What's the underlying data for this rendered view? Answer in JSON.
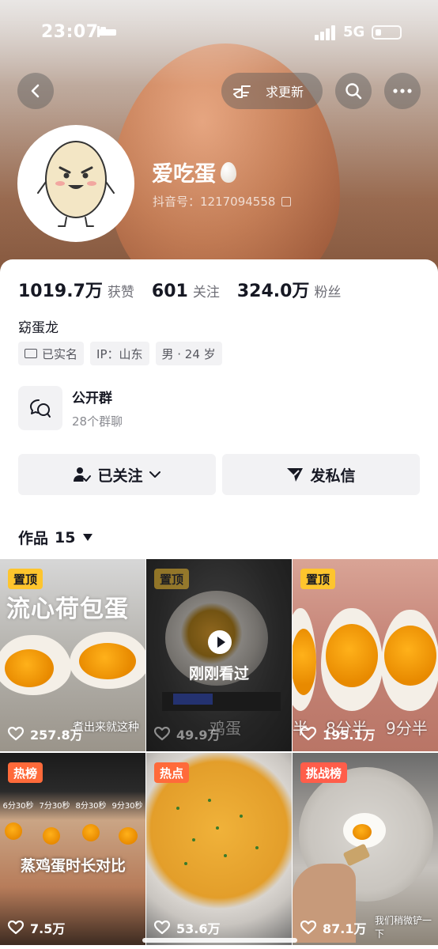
{
  "status_bar": {
    "time": "23:07",
    "network": "5G"
  },
  "header": {
    "request_update_label": "求更新"
  },
  "profile": {
    "nickname": "爱吃蛋",
    "douyin_id": "抖音号：1217094558",
    "stats": [
      {
        "value": "1019.7万",
        "label": "获赞"
      },
      {
        "value": "601",
        "label": "关注"
      },
      {
        "value": "324.0万",
        "label": "粉丝"
      }
    ],
    "bio": "窈蛋龙",
    "tags": [
      "已实名",
      "IP：山东",
      "男 · 24 岁"
    ]
  },
  "group_chat": {
    "title": "公开群",
    "subtitle": "28个群聊"
  },
  "actions": {
    "follow_label": "已关注",
    "message_label": "发私信"
  },
  "works": {
    "label": "作品",
    "count": "15"
  },
  "videos": [
    {
      "badge": "置顶",
      "likes": "257.8万",
      "title": "流心荷包蛋",
      "caption": "煮出来就这种"
    },
    {
      "badge": "置顶",
      "likes": "49.9万",
      "overlay": "刚刚看过",
      "caption": "鸡蛋"
    },
    {
      "badge": "置顶",
      "likes": "195.1万",
      "caption_a": "半",
      "caption_b": "8分半",
      "caption_c": "9分半"
    },
    {
      "badge": "热榜",
      "likes": "7.5万",
      "title": "蒸鸡蛋时长对比",
      "times": [
        "6分30秒",
        "7分30秒",
        "8分30秒",
        "9分30秒"
      ]
    },
    {
      "badge": "热点",
      "likes": "53.6万"
    },
    {
      "badge": "挑战榜",
      "likes": "87.1万",
      "caption": "我们稍微铲一下"
    }
  ],
  "colors": {
    "accent_pin": "#fec52d",
    "hot": "#ff6a3a",
    "text": "#161823"
  }
}
